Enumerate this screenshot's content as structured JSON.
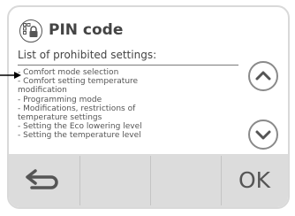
{
  "header": {
    "title": "PIN code",
    "icon": "pin-lock-icon"
  },
  "subtitle": "List of prohibited settings:",
  "settings": [
    "- Comfort mode selection",
    "- Comfort setting temperature",
    "modification",
    "- Programming mode",
    "- Modifications, restrictions of",
    "temperature settings",
    "- Setting the Eco lowering level",
    "- Setting the temperature level"
  ],
  "controls": {
    "scroll_up_icon": "chevron-up-icon",
    "scroll_down_icon": "chevron-down-icon",
    "back_icon": "back-arrow-icon",
    "ok_label": "OK"
  },
  "annotation": {
    "pointer_icon": "arrow-right-icon"
  },
  "colors": {
    "text": "#444444",
    "bar": "#dcdcdc",
    "border": "#d9d9d9"
  }
}
